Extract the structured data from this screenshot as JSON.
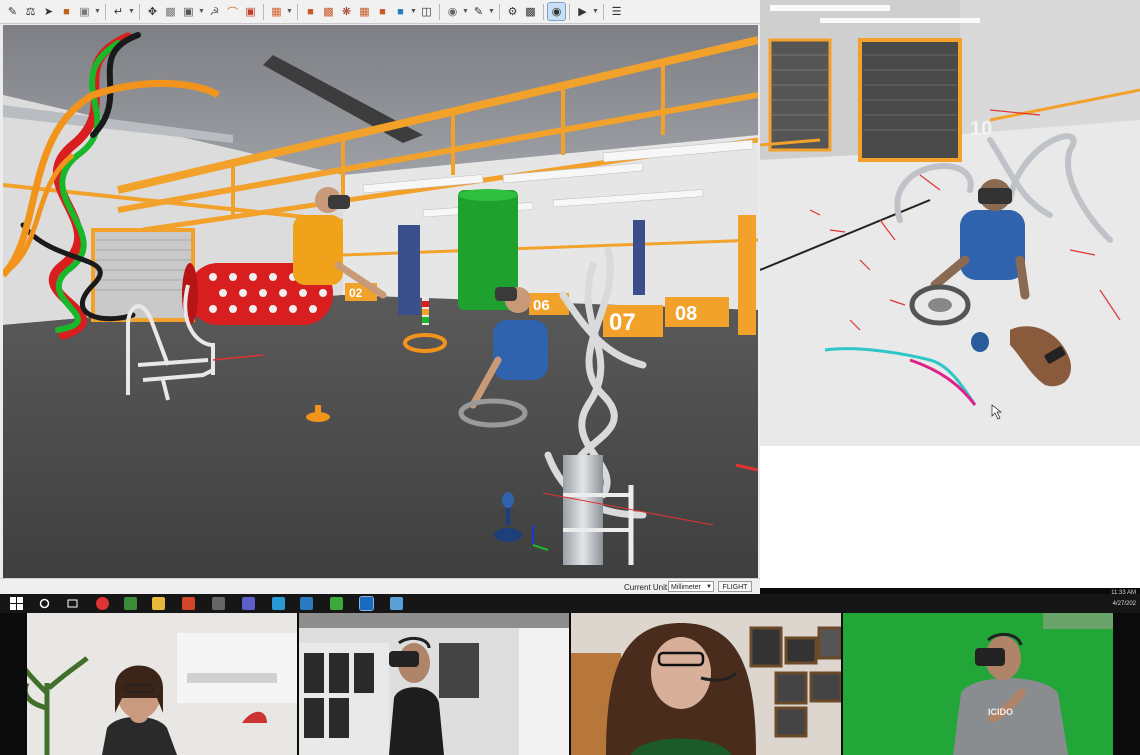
{
  "toolbar": {
    "buttons": [
      "select-icon",
      "transform-icon",
      "pointer-icon",
      "boxes-icon",
      "cube-icon",
      "link-icon",
      "move-icon",
      "small-boxes-icon",
      "shaded-box-icon",
      "mannequin-icon",
      "arc-icon",
      "camera-icon",
      "crate-icon",
      "part-icon",
      "cubes-icon",
      "assembly-icon",
      "palette-icon",
      "window-icon",
      "sphere-icon",
      "note-icon",
      "tools-icon",
      "screen-icon",
      "vr-headset-icon",
      "play-icon",
      "settings-icon"
    ],
    "active_button": "vr-headset-icon"
  },
  "viewport": {
    "bay_numbers": [
      "02",
      "06",
      "07",
      "08"
    ]
  },
  "second_view": {
    "wall_number": "10"
  },
  "statusbar": {
    "unit_label": "Current Unit:",
    "unit_value": "Millimeter",
    "flight_button": "FLIGHT"
  },
  "taskbar": {
    "time": "11:33 AM",
    "date": "4/27/202"
  },
  "participants": [
    {
      "shirt_text": ""
    },
    {
      "shirt_text": ""
    },
    {
      "shirt_text": ""
    },
    {
      "shirt_text": "ICIDO"
    }
  ],
  "colors": {
    "frame_orange": "#f2a12b",
    "floor_gray": "#4a4a4a",
    "green_screen": "#21a637",
    "taskbar": "#161616",
    "toolbar": "#f1f1f1"
  }
}
